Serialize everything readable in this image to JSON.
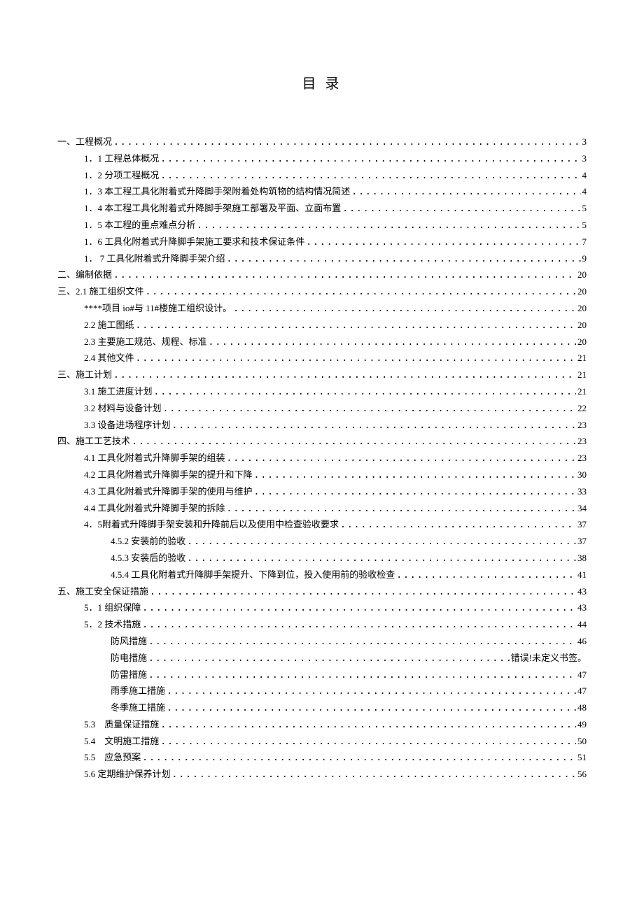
{
  "title": "目 录",
  "lines": [
    {
      "indent": 0,
      "label": "一、工程概况",
      "page": "3"
    },
    {
      "indent": 1,
      "label": "1．1 工程总体概况",
      "page": "3"
    },
    {
      "indent": 1,
      "label": "1．2 分项工程概况",
      "page": "4"
    },
    {
      "indent": 1,
      "label": "1．3 本工程工具化附着式升降脚手架附着处构筑物的结构情况简述",
      "page": "4"
    },
    {
      "indent": 1,
      "label": "1．4 本工程工具化附着式升降脚手架施工部署及平面、立面布置",
      "page": "5"
    },
    {
      "indent": 1,
      "label": "1．5 本工程的重点难点分析",
      "page": "5"
    },
    {
      "indent": 1,
      "label": "1．6 工具化附着式升降脚手架施工要求和技术保证条件",
      "page": "7"
    },
    {
      "indent": 1,
      "label": "1． 7 工具化附着式升降脚手架介绍",
      "page": "9"
    },
    {
      "indent": 0,
      "label": "二、编制依据 ",
      "page": "20"
    },
    {
      "indent": 0,
      "label": "三、2.1 施工组织文件 ",
      "page": "20"
    },
    {
      "indent": 1,
      "label": "****项目 io#与 11#楼施工组织设计。 ",
      "page": "20"
    },
    {
      "indent": 1,
      "label": "2.2 施工图纸",
      "page": "20"
    },
    {
      "indent": 1,
      "label": "2.3 主要施工规范、规程、标准",
      "page": "20"
    },
    {
      "indent": 1,
      "label": "2.4 其他文件",
      "page": "21"
    },
    {
      "indent": 0,
      "label": "三、施工计划",
      "page": "21"
    },
    {
      "indent": 1,
      "label": "3.1 施工进度计划",
      "page": "21"
    },
    {
      "indent": 1,
      "label": "3.2 材料与设备计划",
      "page": "22"
    },
    {
      "indent": 1,
      "label": "3.3 设备进场程序计划",
      "page": "23"
    },
    {
      "indent": 0,
      "label": "四、施工工艺技术 ",
      "page": "23"
    },
    {
      "indent": 1,
      "label": "4.1 工具化附着式升降脚手架的组装",
      "page": "23"
    },
    {
      "indent": 1,
      "label": "4.2 工具化附着式升降脚手架的提升和下降",
      "page": "30"
    },
    {
      "indent": 1,
      "label": "4.3 工具化附着式升降脚手架的使用与维护",
      "page": "33"
    },
    {
      "indent": 1,
      "label": "4.4 工具化附着式升降脚手架的拆除",
      "page": "34"
    },
    {
      "indent": 1,
      "label": "4．5附着式升降脚手架安装和升降前后以及使用中检查验收要求",
      "page": "37"
    },
    {
      "indent": 2,
      "label": "4.5.2 安装前的验收",
      "page": "37"
    },
    {
      "indent": 2,
      "label": "4.5.3 安装后的验收",
      "page": "38"
    },
    {
      "indent": 2,
      "label": "4.5.4 工具化附着式升降脚手架提升、下降到位，投入使用前的验收检查",
      "page": "41"
    },
    {
      "indent": 0,
      "label": "五、施工安全保证措施",
      "page": "43"
    },
    {
      "indent": 1,
      "label": "5．1 组织保障",
      "page": "43"
    },
    {
      "indent": 1,
      "label": "5．2 技术措施",
      "page": "44"
    },
    {
      "indent": 2,
      "label": "防风措施",
      "page": "46"
    },
    {
      "indent": 2,
      "label": "防电措施",
      "page": "错误!未定义书签。"
    },
    {
      "indent": 2,
      "label": "防雷措施",
      "page": "47"
    },
    {
      "indent": 2,
      "label": "雨季施工措施",
      "page": "47"
    },
    {
      "indent": 2,
      "label": "冬季施工措施",
      "page": "48"
    },
    {
      "indent": 1,
      "label": "5.3　质量保证措施",
      "page": "49"
    },
    {
      "indent": 1,
      "label": "5.4　文明施工措施",
      "page": "50"
    },
    {
      "indent": 1,
      "label": "5.5　应急预案",
      "page": "51"
    },
    {
      "indent": 1,
      "label": "5.6 定期维护保养计划",
      "page": "56"
    }
  ]
}
